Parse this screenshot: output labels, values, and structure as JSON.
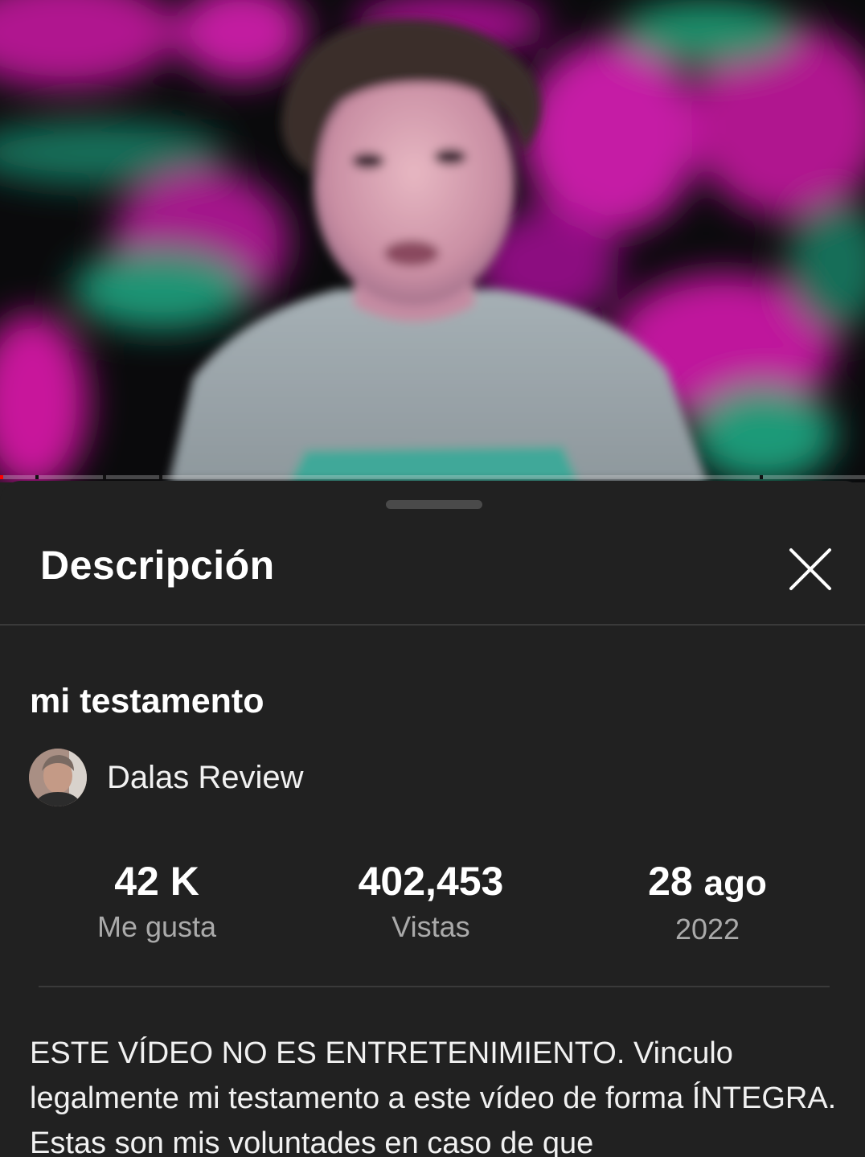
{
  "video": {
    "thumbnail_subject": "creator-speaking-to-camera"
  },
  "sheet": {
    "title": "Descripción",
    "close_icon": "close-icon"
  },
  "details": {
    "video_title": "mi testamento",
    "channel_name": "Dalas Review"
  },
  "stats": {
    "likes_value": "42 K",
    "likes_label": "Me gusta",
    "views_value": "402,453",
    "views_label": "Vistas",
    "date_day": "28",
    "date_month": "ago",
    "date_year": "2022"
  },
  "description": {
    "text": "ESTE VÍDEO NO ES ENTRETENIMIENTO. Vinculo legalmente mi testamento a este vídeo de forma ÍNTEGRA. Estas son mis voluntades en caso de que"
  },
  "colors": {
    "sheet_background": "#212121",
    "secondary_text": "#aaaaaa",
    "progress_played": "#ff0000"
  }
}
